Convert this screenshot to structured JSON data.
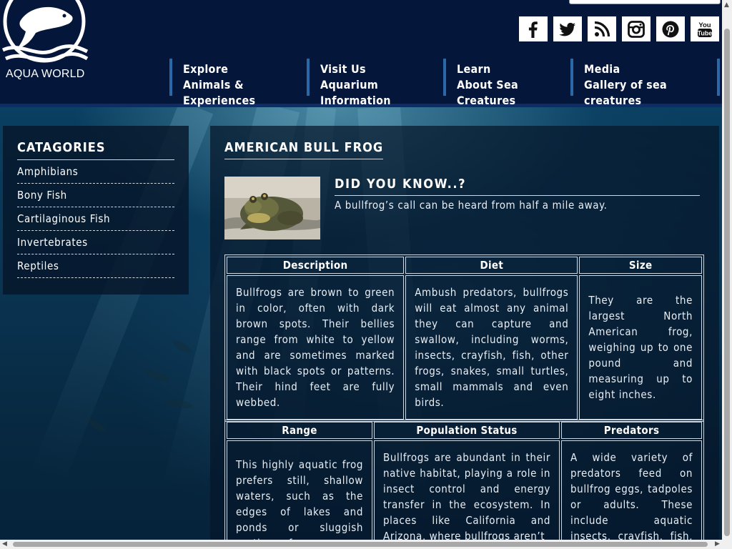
{
  "brand": {
    "name": "AQUA WORLD"
  },
  "socials": [
    {
      "name": "facebook"
    },
    {
      "name": "twitter"
    },
    {
      "name": "rss"
    },
    {
      "name": "instagram"
    },
    {
      "name": "pinterest"
    },
    {
      "name": "youtube",
      "label_top": "You",
      "label_bottom": "Tube"
    }
  ],
  "nav": [
    {
      "title": "Explore",
      "sub": "Animals & Experiences"
    },
    {
      "title": "Visit Us",
      "sub": "Aquarium Information"
    },
    {
      "title": "Learn",
      "sub": "About Sea Creatures"
    },
    {
      "title": "Media",
      "sub": "Gallery of sea creatures"
    }
  ],
  "sidebar": {
    "title": "CATAGORIES",
    "items": [
      "Amphibians",
      "Bony Fish",
      "Cartilaginous Fish",
      "Invertebrates",
      "Reptiles"
    ]
  },
  "main": {
    "title": "AMERICAN BULL FROG",
    "did_you_know": {
      "title": "DID YOU KNOW..?",
      "text": "A bullfrog’s call can be heard from half a mile away."
    },
    "table1": {
      "headers": [
        "Description",
        "Diet",
        "Size"
      ],
      "cells": [
        "Bullfrogs are brown to green in color, often with dark brown spots. Their bellies range from white to yellow and are sometimes marked with black spots or patterns. Their hind feet are fully webbed.",
        "Ambush predators, bullfrogs will eat almost any animal they can capture and swallow, including worms, insects, crayfish, fish, other frogs, snakes, small turtles, small mammals and even birds.",
        "They are the largest North American frog, weighing up to one pound and measuring up to eight inches."
      ]
    },
    "table2": {
      "headers": [
        "Range",
        "Population Status",
        "Predators"
      ],
      "cells": [
        "This highly aquatic frog prefers still, shallow waters, such as the edges of lakes and ponds or sluggish portions of",
        "Bullfrogs are abundant in their native habitat, playing a role in insect control and energy transfer in the ecosystem. In places like California and Arizona, where bullfrogs aren’t",
        "A wide variety of predators feed on bullfrog eggs, tadpoles or adults. These include aquatic insects, crayfish, fish, other"
      ]
    }
  },
  "colors": {
    "header_bg": "#04173a",
    "nav_accent": "#2a68a8",
    "panel_bg": "#06162a",
    "water": "#0a3d5e"
  }
}
